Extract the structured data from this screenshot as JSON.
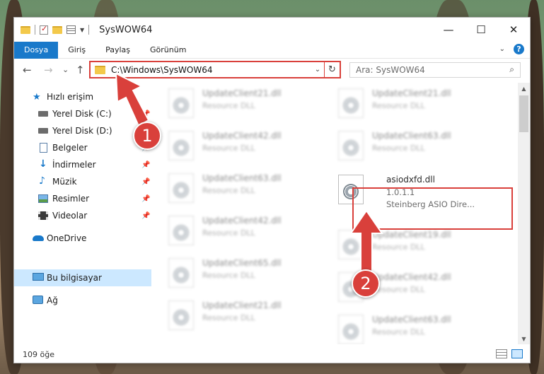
{
  "window": {
    "title": "SysWOW64",
    "controls": {
      "minimize": "—",
      "maximize": "☐",
      "close": "✕"
    }
  },
  "ribbon": {
    "tabs": [
      {
        "label": "Dosya"
      },
      {
        "label": "Giriş"
      },
      {
        "label": "Paylaş"
      },
      {
        "label": "Görünüm"
      }
    ],
    "help": "?"
  },
  "nav": {
    "back": "←",
    "forward": "→",
    "recent": "⌄",
    "up": "↑",
    "address": "C:\\Windows\\SysWOW64",
    "refresh": "↻",
    "search_placeholder": "Ara: SysWOW64"
  },
  "sidebar": {
    "items": [
      {
        "label": "Hızlı erişim",
        "icon": "star-icon"
      },
      {
        "label": "Yerel Disk (C:)",
        "icon": "drive-icon",
        "pinned": true
      },
      {
        "label": "Yerel Disk (D:)",
        "icon": "drive-icon",
        "pinned": true
      },
      {
        "label": "Belgeler",
        "icon": "documents-icon",
        "pinned": true
      },
      {
        "label": "İndirmeler",
        "icon": "download-icon",
        "pinned": true
      },
      {
        "label": "Müzik",
        "icon": "music-icon",
        "pinned": true
      },
      {
        "label": "Resimler",
        "icon": "pictures-icon",
        "pinned": true
      },
      {
        "label": "Videolar",
        "icon": "videos-icon",
        "pinned": true
      },
      {
        "label": "OneDrive",
        "icon": "cloud-icon"
      },
      {
        "label": "Bu bilgisayar",
        "icon": "computer-icon",
        "selected": true
      },
      {
        "label": "Ağ",
        "icon": "network-icon"
      }
    ]
  },
  "files": {
    "left": [
      {
        "name": "UpdateClient21.dll",
        "type": "Resource DLL"
      },
      {
        "name": "UpdateClient42.dll",
        "type": "Resource DLL"
      },
      {
        "name": "UpdateClient63.dll",
        "type": "Resource DLL"
      },
      {
        "name": "UpdateClient42.dll",
        "type": "Resource DLL"
      },
      {
        "name": "UpdateClient65.dll",
        "type": "Resource DLL"
      },
      {
        "name": "UpdateClient21.dll",
        "type": "Resource DLL"
      }
    ],
    "right": [
      {
        "name": "UpdateClient21.dll",
        "type": "Resource DLL"
      },
      {
        "name": "UpdateClient63.dll",
        "type": "Resource DLL"
      },
      {
        "name": "UpdateClient19.dll",
        "type": "Resource DLL"
      },
      {
        "name": "UpdateClient42.dll",
        "type": "Resource DLL"
      },
      {
        "name": "UpdateClient63.dll",
        "type": "Resource DLL"
      }
    ],
    "highlighted": {
      "name": "asiodxfd.dll",
      "version": "1.0.1.1",
      "description": "Steinberg ASIO Dire..."
    }
  },
  "status": {
    "count": "109 öğe"
  },
  "callouts": {
    "one": "1",
    "two": "2"
  },
  "colors": {
    "accent": "#1979ca",
    "callout": "#d9403b",
    "selection": "#cce8ff"
  }
}
